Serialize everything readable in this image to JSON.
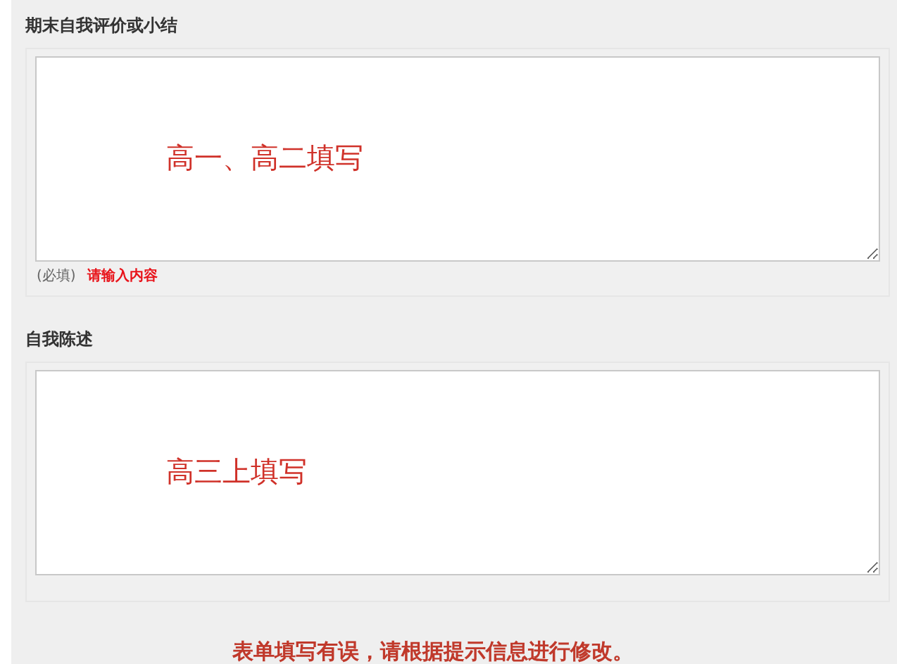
{
  "sections": [
    {
      "label": "期末自我评价或小结",
      "value": "高一、高二填写",
      "required_note": "(必填)",
      "error": "请输入内容"
    },
    {
      "label": "自我陈述",
      "value": "高三上填写"
    }
  ],
  "form_error": "表单填写有误，请根据提示信息进行修改。"
}
